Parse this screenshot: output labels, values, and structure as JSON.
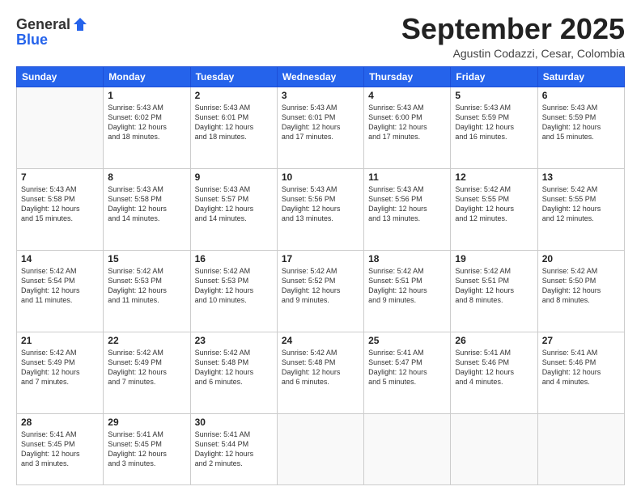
{
  "header": {
    "logo_line1": "General",
    "logo_line2": "Blue",
    "month": "September 2025",
    "location": "Agustin Codazzi, Cesar, Colombia"
  },
  "weekdays": [
    "Sunday",
    "Monday",
    "Tuesday",
    "Wednesday",
    "Thursday",
    "Friday",
    "Saturday"
  ],
  "weeks": [
    [
      {
        "day": "",
        "sunrise": "",
        "sunset": "",
        "daylight": ""
      },
      {
        "day": "1",
        "sunrise": "Sunrise: 5:43 AM",
        "sunset": "Sunset: 6:02 PM",
        "daylight": "Daylight: 12 hours and 18 minutes."
      },
      {
        "day": "2",
        "sunrise": "Sunrise: 5:43 AM",
        "sunset": "Sunset: 6:01 PM",
        "daylight": "Daylight: 12 hours and 18 minutes."
      },
      {
        "day": "3",
        "sunrise": "Sunrise: 5:43 AM",
        "sunset": "Sunset: 6:01 PM",
        "daylight": "Daylight: 12 hours and 17 minutes."
      },
      {
        "day": "4",
        "sunrise": "Sunrise: 5:43 AM",
        "sunset": "Sunset: 6:00 PM",
        "daylight": "Daylight: 12 hours and 17 minutes."
      },
      {
        "day": "5",
        "sunrise": "Sunrise: 5:43 AM",
        "sunset": "Sunset: 5:59 PM",
        "daylight": "Daylight: 12 hours and 16 minutes."
      },
      {
        "day": "6",
        "sunrise": "Sunrise: 5:43 AM",
        "sunset": "Sunset: 5:59 PM",
        "daylight": "Daylight: 12 hours and 15 minutes."
      }
    ],
    [
      {
        "day": "7",
        "sunrise": "Sunrise: 5:43 AM",
        "sunset": "Sunset: 5:58 PM",
        "daylight": "Daylight: 12 hours and 15 minutes."
      },
      {
        "day": "8",
        "sunrise": "Sunrise: 5:43 AM",
        "sunset": "Sunset: 5:58 PM",
        "daylight": "Daylight: 12 hours and 14 minutes."
      },
      {
        "day": "9",
        "sunrise": "Sunrise: 5:43 AM",
        "sunset": "Sunset: 5:57 PM",
        "daylight": "Daylight: 12 hours and 14 minutes."
      },
      {
        "day": "10",
        "sunrise": "Sunrise: 5:43 AM",
        "sunset": "Sunset: 5:56 PM",
        "daylight": "Daylight: 12 hours and 13 minutes."
      },
      {
        "day": "11",
        "sunrise": "Sunrise: 5:43 AM",
        "sunset": "Sunset: 5:56 PM",
        "daylight": "Daylight: 12 hours and 13 minutes."
      },
      {
        "day": "12",
        "sunrise": "Sunrise: 5:42 AM",
        "sunset": "Sunset: 5:55 PM",
        "daylight": "Daylight: 12 hours and 12 minutes."
      },
      {
        "day": "13",
        "sunrise": "Sunrise: 5:42 AM",
        "sunset": "Sunset: 5:55 PM",
        "daylight": "Daylight: 12 hours and 12 minutes."
      }
    ],
    [
      {
        "day": "14",
        "sunrise": "Sunrise: 5:42 AM",
        "sunset": "Sunset: 5:54 PM",
        "daylight": "Daylight: 12 hours and 11 minutes."
      },
      {
        "day": "15",
        "sunrise": "Sunrise: 5:42 AM",
        "sunset": "Sunset: 5:53 PM",
        "daylight": "Daylight: 12 hours and 11 minutes."
      },
      {
        "day": "16",
        "sunrise": "Sunrise: 5:42 AM",
        "sunset": "Sunset: 5:53 PM",
        "daylight": "Daylight: 12 hours and 10 minutes."
      },
      {
        "day": "17",
        "sunrise": "Sunrise: 5:42 AM",
        "sunset": "Sunset: 5:52 PM",
        "daylight": "Daylight: 12 hours and 9 minutes."
      },
      {
        "day": "18",
        "sunrise": "Sunrise: 5:42 AM",
        "sunset": "Sunset: 5:51 PM",
        "daylight": "Daylight: 12 hours and 9 minutes."
      },
      {
        "day": "19",
        "sunrise": "Sunrise: 5:42 AM",
        "sunset": "Sunset: 5:51 PM",
        "daylight": "Daylight: 12 hours and 8 minutes."
      },
      {
        "day": "20",
        "sunrise": "Sunrise: 5:42 AM",
        "sunset": "Sunset: 5:50 PM",
        "daylight": "Daylight: 12 hours and 8 minutes."
      }
    ],
    [
      {
        "day": "21",
        "sunrise": "Sunrise: 5:42 AM",
        "sunset": "Sunset: 5:49 PM",
        "daylight": "Daylight: 12 hours and 7 minutes."
      },
      {
        "day": "22",
        "sunrise": "Sunrise: 5:42 AM",
        "sunset": "Sunset: 5:49 PM",
        "daylight": "Daylight: 12 hours and 7 minutes."
      },
      {
        "day": "23",
        "sunrise": "Sunrise: 5:42 AM",
        "sunset": "Sunset: 5:48 PM",
        "daylight": "Daylight: 12 hours and 6 minutes."
      },
      {
        "day": "24",
        "sunrise": "Sunrise: 5:42 AM",
        "sunset": "Sunset: 5:48 PM",
        "daylight": "Daylight: 12 hours and 6 minutes."
      },
      {
        "day": "25",
        "sunrise": "Sunrise: 5:41 AM",
        "sunset": "Sunset: 5:47 PM",
        "daylight": "Daylight: 12 hours and 5 minutes."
      },
      {
        "day": "26",
        "sunrise": "Sunrise: 5:41 AM",
        "sunset": "Sunset: 5:46 PM",
        "daylight": "Daylight: 12 hours and 4 minutes."
      },
      {
        "day": "27",
        "sunrise": "Sunrise: 5:41 AM",
        "sunset": "Sunset: 5:46 PM",
        "daylight": "Daylight: 12 hours and 4 minutes."
      }
    ],
    [
      {
        "day": "28",
        "sunrise": "Sunrise: 5:41 AM",
        "sunset": "Sunset: 5:45 PM",
        "daylight": "Daylight: 12 hours and 3 minutes."
      },
      {
        "day": "29",
        "sunrise": "Sunrise: 5:41 AM",
        "sunset": "Sunset: 5:45 PM",
        "daylight": "Daylight: 12 hours and 3 minutes."
      },
      {
        "day": "30",
        "sunrise": "Sunrise: 5:41 AM",
        "sunset": "Sunset: 5:44 PM",
        "daylight": "Daylight: 12 hours and 2 minutes."
      },
      {
        "day": "",
        "sunrise": "",
        "sunset": "",
        "daylight": ""
      },
      {
        "day": "",
        "sunrise": "",
        "sunset": "",
        "daylight": ""
      },
      {
        "day": "",
        "sunrise": "",
        "sunset": "",
        "daylight": ""
      },
      {
        "day": "",
        "sunrise": "",
        "sunset": "",
        "daylight": ""
      }
    ]
  ]
}
